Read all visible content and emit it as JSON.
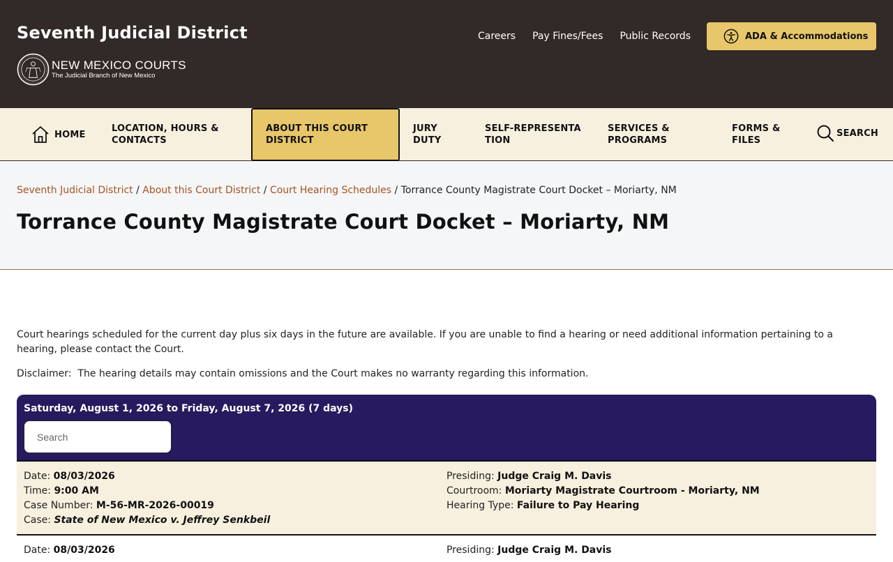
{
  "header": {
    "site_title": "Seventh Judicial District",
    "logo_main": "NEW MEXICO COURTS",
    "logo_sub": "The Judicial Branch of New Mexico",
    "links": [
      "Careers",
      "Pay Fines/Fees",
      "Public Records"
    ],
    "ada_label": "ADA & Accommodations"
  },
  "nav": {
    "home": "HOME",
    "location": "LOCATION, HOURS & CONTACTS",
    "about": "ABOUT THIS COURT DISTRICT",
    "jury": "JURY DUTY",
    "self_rep": "SELF-REPRESENTATION",
    "services": "SERVICES & PROGRAMS",
    "forms": "FORMS & FILES",
    "search": "SEARCH"
  },
  "breadcrumb": {
    "items": [
      "Seventh Judicial District",
      "About this Court District",
      "Court Hearing Schedules"
    ],
    "current": "Torrance County Magistrate Court Docket – Moriarty, NM",
    "separator": "/"
  },
  "page_title": "Torrance County Magistrate Court Docket – Moriarty, NM",
  "intro": "Court hearings scheduled for the current day plus six days in the future are available. If you are unable to find a hearing or need additional information pertaining to a hearing, please contact the Court.",
  "disclaimer": "Disclaimer:  The hearing details may contain omissions and the Court makes no warranty regarding this information.",
  "docket": {
    "range": "Saturday, August 1, 2026 to Friday, August 7, 2026 (7 days)",
    "search_placeholder": "Search",
    "labels": {
      "date": "Date:",
      "time": "Time:",
      "case_number": "Case Number:",
      "case": "Case:",
      "presiding": "Presiding:",
      "courtroom": "Courtroom:",
      "hearing_type": "Hearing Type:"
    },
    "hearings": [
      {
        "date": "08/03/2026",
        "time": "9:00 AM",
        "case_number": "M-56-MR-2026-00019",
        "case": "State of New Mexico v. Jeffrey Senkbeil",
        "presiding": "Judge Craig M. Davis",
        "courtroom": "Moriarty Magistrate Courtroom - Moriarty, NM",
        "hearing_type": "Failure to Pay Hearing"
      },
      {
        "date": "08/03/2026",
        "presiding": "Judge Craig M. Davis"
      }
    ]
  },
  "colors": {
    "header_bg": "#312a27",
    "accent_gold": "#e8c66a",
    "nav_bg": "#f8f0df",
    "link_rust": "#a9531e",
    "docket_purple": "#271a5e"
  }
}
